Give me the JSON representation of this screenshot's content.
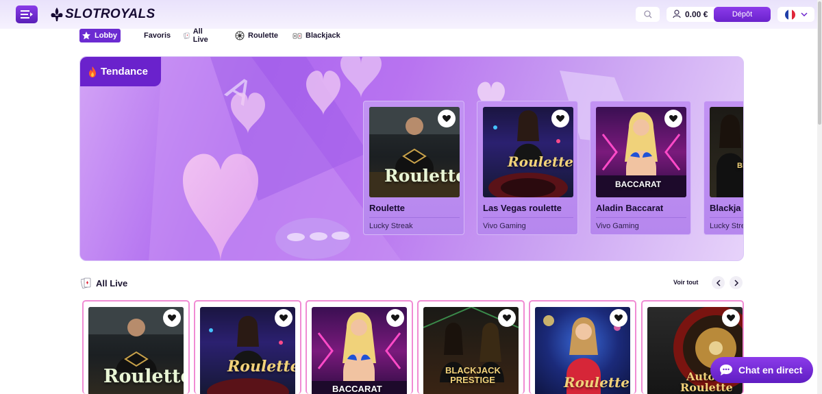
{
  "header": {
    "logo_text": "SLOTROYALS",
    "balance": "0.00 €",
    "deposit_label": "Dépôt",
    "language_flag": "france-flag-icon"
  },
  "nav": {
    "tabs": [
      {
        "label": "Lobby",
        "icon": "star-icon",
        "active": true
      },
      {
        "label": "Favoris",
        "icon": null,
        "active": false
      },
      {
        "label": "All Live",
        "icon": "cards-icon",
        "active": false
      },
      {
        "label": "Roulette",
        "icon": "roulette-wheel-icon",
        "active": false
      },
      {
        "label": "Blackjack",
        "icon": "blackjack-icon",
        "active": false
      }
    ]
  },
  "trending": {
    "label": "Tendance",
    "icon": "fire-icon",
    "cards": [
      {
        "title": "Roulette",
        "provider": "Lucky Streak",
        "image_caption": "Roulette"
      },
      {
        "title": "Las Vegas roulette",
        "provider": "Vivo Gaming",
        "image_caption": "Roulette"
      },
      {
        "title": "Aladin Baccarat",
        "provider": "Vivo Gaming",
        "image_caption": "BACCARAT"
      },
      {
        "title": "Blackja",
        "provider": "Lucky Stre",
        "image_caption": "BLA PR"
      }
    ]
  },
  "all_live": {
    "title": "All Live",
    "see_all": "Voir tout",
    "cards": [
      {
        "image_caption": "Roulette"
      },
      {
        "image_caption": "Roulette"
      },
      {
        "image_caption": "BACCARAT"
      },
      {
        "image_caption": "BLACKJACK PRESTIGE"
      },
      {
        "image_caption": "Roulette"
      },
      {
        "image_caption": "Auto Roulette"
      }
    ]
  },
  "chat": {
    "label": "Chat en direct"
  },
  "colors": {
    "accent": "#6a22cc",
    "accent_light": "#8c3bea",
    "card_border": "#f08bd3"
  }
}
